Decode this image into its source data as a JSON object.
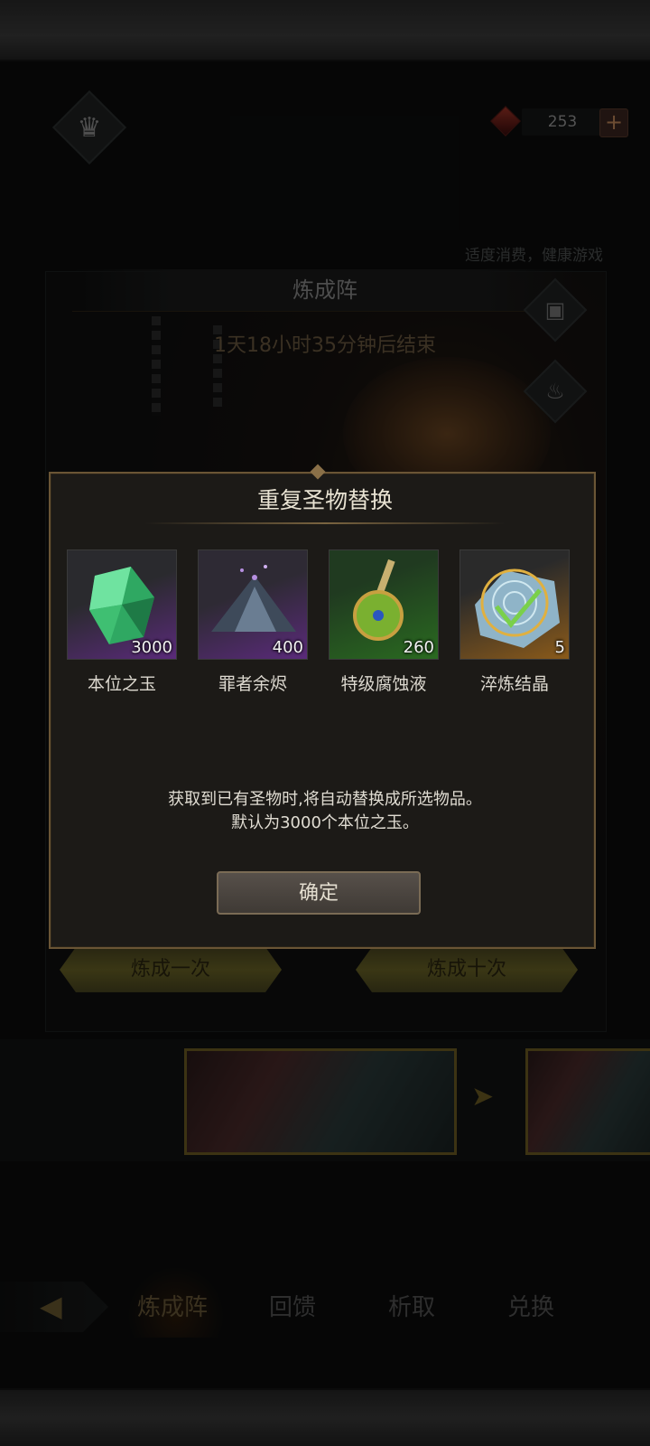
{
  "header": {
    "currency_amount": "253",
    "add_label": "+",
    "notice": "适度消费，健康游戏"
  },
  "stage": {
    "title": "炼成阵",
    "countdown": "1天18小时35分钟后结束",
    "forge_once": "炼成一次",
    "forge_ten": "炼成十次"
  },
  "modal": {
    "title": "重复圣物替换",
    "items": [
      {
        "name": "本位之玉",
        "qty": "3000",
        "icon": "green-crystal-icon"
      },
      {
        "name": "罪者余烬",
        "qty": "400",
        "icon": "ash-pile-icon"
      },
      {
        "name": "特级腐蚀液",
        "qty": "260",
        "icon": "potion-vial-icon"
      },
      {
        "name": "淬炼结晶",
        "qty": "5",
        "icon": "rune-stone-icon"
      }
    ],
    "desc_line1": "获取到已有圣物时,将自动替换成所选物品。",
    "desc_line2": "默认为3000个本位之玉。",
    "confirm": "确定"
  },
  "nav": {
    "tabs": [
      "炼成阵",
      "回馈",
      "析取",
      "兑换"
    ],
    "active": "炼成阵"
  },
  "colors": {
    "modal_border": "#6a5535",
    "gold_button": "#6a6427",
    "green_crystal": "#3fbf72"
  }
}
